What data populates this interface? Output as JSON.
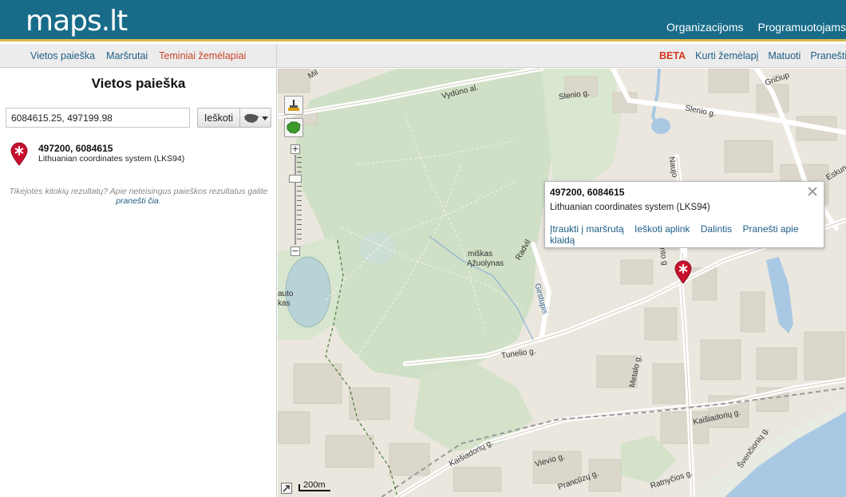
{
  "header": {
    "logo": "maps.lt",
    "nav": [
      "Organizacijoms",
      "Programuotojams"
    ]
  },
  "subnav": {
    "left": [
      "Vietos paieška",
      "Maršrutai",
      "Teminiai žemėlapiai"
    ],
    "beta": "BETA",
    "right": [
      "Kurti žemėlapį",
      "Matuoti",
      "Pranešti a"
    ]
  },
  "sidebar": {
    "title": "Vietos paieška",
    "search_value": "6084615.25, 497199.98",
    "search_button": "Ieškoti",
    "result": {
      "title": "497200, 6084615",
      "subtitle": "Lithuanian coordinates system (LKS94)"
    },
    "hint_text": "Tikėjotės kitokių rezultatų? Apie neteisingus paieškos rezultatus galite",
    "hint_link": "pranešti čia",
    "hint_end": "."
  },
  "map": {
    "popup": {
      "title": "497200, 6084615",
      "subtitle": "Lithuanian coordinates system (LKS94)",
      "links": [
        "Įtraukti į maršrutą",
        "Ieškoti aplink",
        "Dalintis",
        "Pranešti apie klaidą"
      ]
    },
    "scale_label": "200m",
    "labels": {
      "park1": "miškas",
      "park2": "Ąžuolynas",
      "vyduno": "Vydūno al.",
      "slenio1": "Slenio g.",
      "slenio2": "Slenio g.",
      "tunelio": "Tunelio g.",
      "girstupis": "Girstupis",
      "radvil": "Radvil",
      "kaisiadoriu1": "Kaišiadorių g.",
      "kaisiadoriu2": "Kaišiadorių g.",
      "vievio": "Vievio g.",
      "pranculio": "Prancūzų g.",
      "ratnycios": "Ratnyčios g.",
      "svencioniu": "Švenčionių g.",
      "metalo": "Metalo g.",
      "naujo": "Naujo",
      "gricup": "Gričiup",
      "eskune": "Eskunė",
      "mil": "Mil",
      "auto": "auto",
      "kas": "kas",
      "nto": "nto g"
    }
  }
}
